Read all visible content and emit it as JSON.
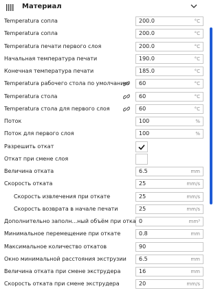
{
  "header": {
    "title": "Материал",
    "icon": "material-bars-icon",
    "collapse_icon": "chevron-down-icon"
  },
  "settings": [
    {
      "label": "Temperatura сопла",
      "value": "200.0",
      "unit": "°C",
      "type": "field"
    },
    {
      "label": "Temperatura сопла",
      "value": "200.0",
      "unit": "°C",
      "type": "field"
    },
    {
      "label": "Temperatura печати первого слоя",
      "value": "200.0",
      "unit": "°C",
      "type": "field"
    },
    {
      "label": "Начальная температура печати",
      "value": "190.0",
      "unit": "°C",
      "type": "field"
    },
    {
      "label": "Конечная температура печати",
      "value": "185.0",
      "unit": "°C",
      "type": "field"
    },
    {
      "label": "Temperatura рабочего стола по умолчанию",
      "value": "60",
      "unit": "°C",
      "type": "field",
      "linked": true
    },
    {
      "label": "Temperatura стола",
      "value": "60",
      "unit": "°C",
      "type": "field",
      "linked": true
    },
    {
      "label": "Temperatura стола для первого слоя",
      "value": "60",
      "unit": "°C",
      "type": "field",
      "linked": true
    },
    {
      "label": "Поток",
      "value": "100",
      "unit": "%",
      "type": "field"
    },
    {
      "label": "Поток для первого слоя",
      "value": "100",
      "unit": "%",
      "type": "field"
    },
    {
      "label": "Разрешить откат",
      "checked": true,
      "type": "checkbox"
    },
    {
      "label": "Откат при смене слоя",
      "checked": false,
      "type": "checkbox"
    },
    {
      "label": "Величина отката",
      "value": "6.5",
      "unit": "mm",
      "type": "field"
    },
    {
      "label": "Скорость отката",
      "value": "25",
      "unit": "mm/s",
      "type": "field"
    },
    {
      "label": "Скорость извлечения при откате",
      "value": "25",
      "unit": "mm/s",
      "type": "field",
      "indent": true
    },
    {
      "label": "Скорость возврата в начале печати",
      "value": "25",
      "unit": "mm/s",
      "type": "field",
      "indent": true
    },
    {
      "label": "Дополнительно заполн...ный объём при откате",
      "value": "0",
      "unit": "mm³",
      "type": "field"
    },
    {
      "label": "Минимальное перемещение при откате",
      "value": "0.8",
      "unit": "mm",
      "type": "field"
    },
    {
      "label": "Максимальное количество откатов",
      "value": "90",
      "unit": "",
      "type": "field"
    },
    {
      "label": "Окно минимальной расстояния экструзии",
      "value": "6.5",
      "unit": "mm",
      "type": "field"
    },
    {
      "label": "Величина отката при смене экструдера",
      "value": "16",
      "unit": "mm",
      "type": "field"
    },
    {
      "label": "Скорость отката при смене экструдера",
      "value": "20",
      "unit": "mm/s",
      "type": "field"
    }
  ]
}
